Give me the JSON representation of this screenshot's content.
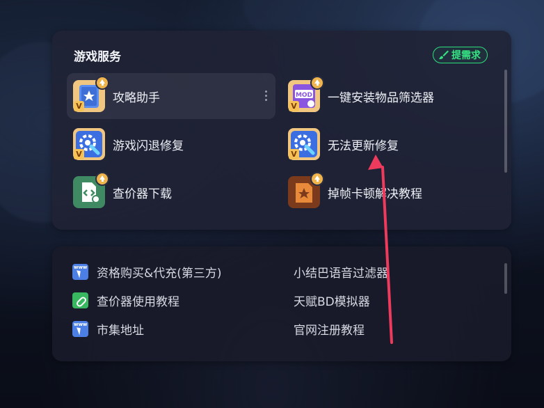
{
  "service_panel": {
    "title": "游戏服务",
    "request_button": "提需求",
    "items": [
      {
        "label": "攻略助手",
        "icon": "guide-book-icon"
      },
      {
        "label": "一键安装物品筛选器",
        "icon": "mod-file-icon"
      },
      {
        "label": "游戏闪退修复",
        "icon": "repair-gear-icon"
      },
      {
        "label": "无法更新修复",
        "icon": "repair-gear-icon"
      },
      {
        "label": "查价器下载",
        "icon": "code-file-icon"
      },
      {
        "label": "掉帧卡顿解决教程",
        "icon": "lag-fix-icon"
      }
    ],
    "badge_letter": "V"
  },
  "links_panel": {
    "items": [
      {
        "label": "资格购买&代充(第三方)",
        "icon": "www-link-icon"
      },
      {
        "label": "小结巴语音过滤器",
        "icon": ""
      },
      {
        "label": "查价器使用教程",
        "icon": "chain-link-icon"
      },
      {
        "label": "天赋BD模拟器",
        "icon": ""
      },
      {
        "label": "市集地址",
        "icon": "www-link-icon"
      },
      {
        "label": "官网注册教程",
        "icon": ""
      }
    ]
  },
  "colors": {
    "accent_green": "#2ee07d",
    "annotation_red": "#ee3a5c",
    "badge_gold": "#f6c257"
  }
}
